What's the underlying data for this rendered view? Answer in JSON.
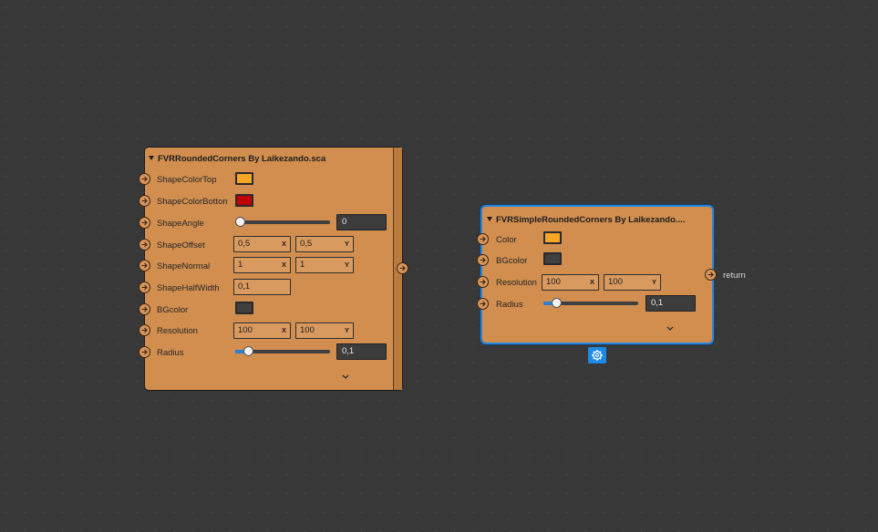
{
  "colors": {
    "background": "#2b2b2b",
    "node": "#d18e4f",
    "selection": "#2a84d8",
    "slider_fill": "#2a7fd6"
  },
  "node1": {
    "title": "FVRRoundedCorners By Laikezando.sca",
    "rows": {
      "shape_color_top": {
        "label": "ShapeColorTop",
        "color": "#f5a623"
      },
      "shape_color_botton": {
        "label": "ShapeColorBotton",
        "color": "#c00000"
      },
      "shape_angle": {
        "label": "ShapeAngle",
        "value": "0",
        "slider_fraction": 0
      },
      "shape_offset": {
        "label": "ShapeOffset",
        "x": "0,5",
        "x_axis": "X",
        "y": "0,5",
        "y_axis": "Y"
      },
      "shape_normal": {
        "label": "ShapeNormal",
        "x": "1",
        "x_axis": "X",
        "y": "1",
        "y_axis": "Y"
      },
      "shape_half_width": {
        "label": "ShapeHalfWidth",
        "value": "0,1"
      },
      "bg_color": {
        "label": "BGcolor",
        "color": "#404040"
      },
      "resolution": {
        "label": "Resolution",
        "x": "100",
        "x_axis": "X",
        "y": "100",
        "y_axis": "Y"
      },
      "radius": {
        "label": "Radius",
        "value": "0,1",
        "slider_fraction": 0.1
      }
    },
    "expand_icon": "chevron-down-icon"
  },
  "node2": {
    "title": "FVRSimpleRoundedCorners By Laikezando....",
    "rows": {
      "color": {
        "label": "Color",
        "color": "#f5a623"
      },
      "bg_color": {
        "label": "BGcolor",
        "color": "#404040"
      },
      "resolution": {
        "label": "Resolution",
        "x": "100",
        "x_axis": "X",
        "y": "100",
        "y_axis": "Y"
      },
      "radius": {
        "label": "Radius",
        "value": "0,1",
        "slider_fraction": 0.1
      }
    },
    "output_label": "return",
    "expand_icon": "chevron-down-icon",
    "settings_icon": "gear-icon"
  }
}
